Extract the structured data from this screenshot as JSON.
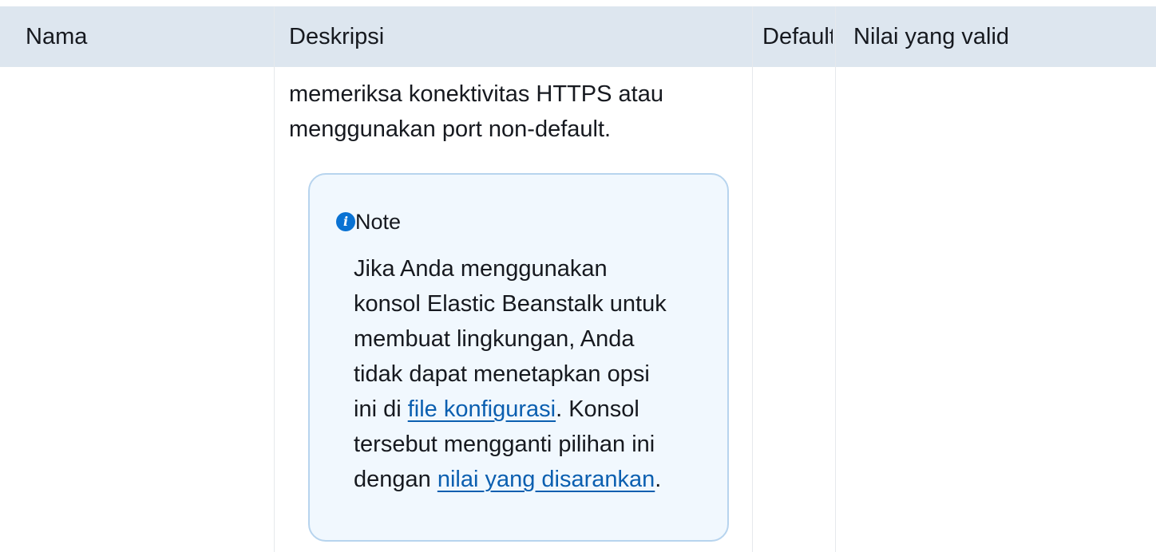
{
  "table": {
    "headers": {
      "name": "Nama",
      "description": "Deskripsi",
      "default": "Default",
      "valid_values": "Nilai yang valid"
    }
  },
  "row": {
    "description_lines": [
      "memeriksa konektivitas HTTPS atau",
      "menggunakan port non-default."
    ],
    "note": {
      "icon": "info-icon",
      "icon_glyph": "i",
      "title": "Note",
      "lines": [
        "Jika Anda menggunakan",
        "konsol Elastic Beanstalk untuk",
        "membuat lingkungan, Anda",
        "tidak dapat menetapkan opsi"
      ],
      "line5_prefix": "ini di ",
      "link1": "file konfigurasi",
      "line5_suffix": ". Konsol",
      "line6": "tersebut mengganti pilihan ini",
      "line7_prefix": "dengan ",
      "link2": "nilai yang disarankan",
      "line7_suffix": "."
    }
  },
  "colors": {
    "header_bg": "#dde6ef",
    "note_bg": "#f1f8fe",
    "note_border": "#b7d4ee",
    "link": "#0b5fb0",
    "info_icon": "#0972d3"
  }
}
